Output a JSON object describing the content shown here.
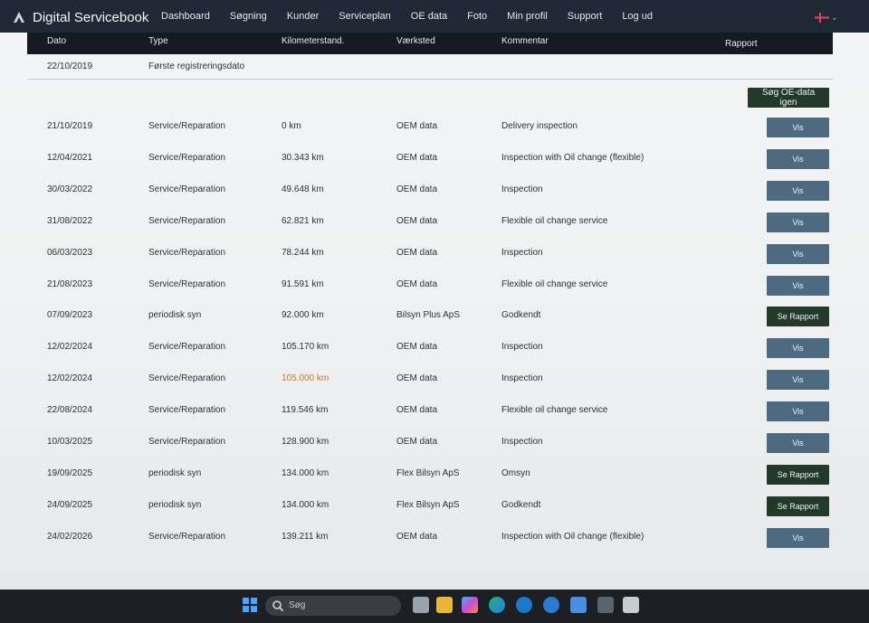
{
  "app": {
    "title": "Digital Servicebook"
  },
  "nav": [
    "Dashboard",
    "Søgning",
    "Kunder",
    "Serviceplan",
    "OE data",
    "Foto",
    "Min profil",
    "Support",
    "Log ud"
  ],
  "table": {
    "headers": {
      "date": "Dato",
      "type": "Type",
      "km": "Kilometerstand.",
      "workshop": "Værksted",
      "comment": "Kommentar",
      "report": "Rapport"
    },
    "first_registration": {
      "date": "22/10/2019",
      "type": "Første registreringsdato"
    },
    "search_button": "Søg OE-data igen",
    "rows": [
      {
        "date": "21/10/2019",
        "type": "Service/Reparation",
        "km": "0 km",
        "workshop": "OEM data",
        "comment": "Delivery inspection",
        "action": "Vis"
      },
      {
        "date": "12/04/2021",
        "type": "Service/Reparation",
        "km": "30.343 km",
        "workshop": "OEM data",
        "comment": "Inspection with Oil change (flexible)",
        "action": "Vis"
      },
      {
        "date": "30/03/2022",
        "type": "Service/Reparation",
        "km": "49.648 km",
        "workshop": "OEM data",
        "comment": "Inspection",
        "action": "Vis"
      },
      {
        "date": "31/08/2022",
        "type": "Service/Reparation",
        "km": "62.821 km",
        "workshop": "OEM data",
        "comment": "Flexible oil change service",
        "action": "Vis"
      },
      {
        "date": "06/03/2023",
        "type": "Service/Reparation",
        "km": "78.244 km",
        "workshop": "OEM data",
        "comment": "Inspection",
        "action": "Vis"
      },
      {
        "date": "21/08/2023",
        "type": "Service/Reparation",
        "km": "91.591 km",
        "workshop": "OEM data",
        "comment": "Flexible oil change service",
        "action": "Vis"
      },
      {
        "date": "07/09/2023",
        "type": "periodisk syn",
        "km": "92.000 km",
        "workshop": "Bilsyn Plus ApS",
        "comment": "Godkendt",
        "action": "Se Rapport"
      },
      {
        "date": "12/02/2024",
        "type": "Service/Reparation",
        "km": "105.170 km",
        "workshop": "OEM data",
        "comment": "Inspection",
        "action": "Vis"
      },
      {
        "date": "12/02/2024",
        "type": "Service/Reparation",
        "km": "105.000 km",
        "workshop": "OEM data",
        "comment": "Inspection",
        "action": "Vis",
        "highlight": true
      },
      {
        "date": "22/08/2024",
        "type": "Service/Reparation",
        "km": "119.546 km",
        "workshop": "OEM data",
        "comment": "Flexible oil change service",
        "action": "Vis"
      },
      {
        "date": "10/03/2025",
        "type": "Service/Reparation",
        "km": "128.900 km",
        "workshop": "OEM data",
        "comment": "Inspection",
        "action": "Vis"
      },
      {
        "date": "19/09/2025",
        "type": "periodisk syn",
        "km": "134.000 km",
        "workshop": "Flex Bilsyn ApS",
        "comment": "Omsyn",
        "action": "Se Rapport"
      },
      {
        "date": "24/09/2025",
        "type": "periodisk syn",
        "km": "134.000 km",
        "workshop": "Flex Bilsyn ApS",
        "comment": "Godkendt",
        "action": "Se Rapport"
      },
      {
        "date": "24/02/2026",
        "type": "Service/Reparation",
        "km": "139.211 km",
        "workshop": "OEM data",
        "comment": "Inspection with Oil change (flexible)",
        "action": "Vis"
      }
    ]
  },
  "taskbar": {
    "search_label": "Søg"
  },
  "colors": {
    "topbar": "#1f2a36",
    "vis_button": "#4e6a80",
    "report_button": "#233a2a",
    "km_highlight": "#c8781b"
  },
  "icons": [
    "servicebook-logo-icon",
    "danish-flag-icon",
    "windows-start-icon",
    "search-icon"
  ]
}
